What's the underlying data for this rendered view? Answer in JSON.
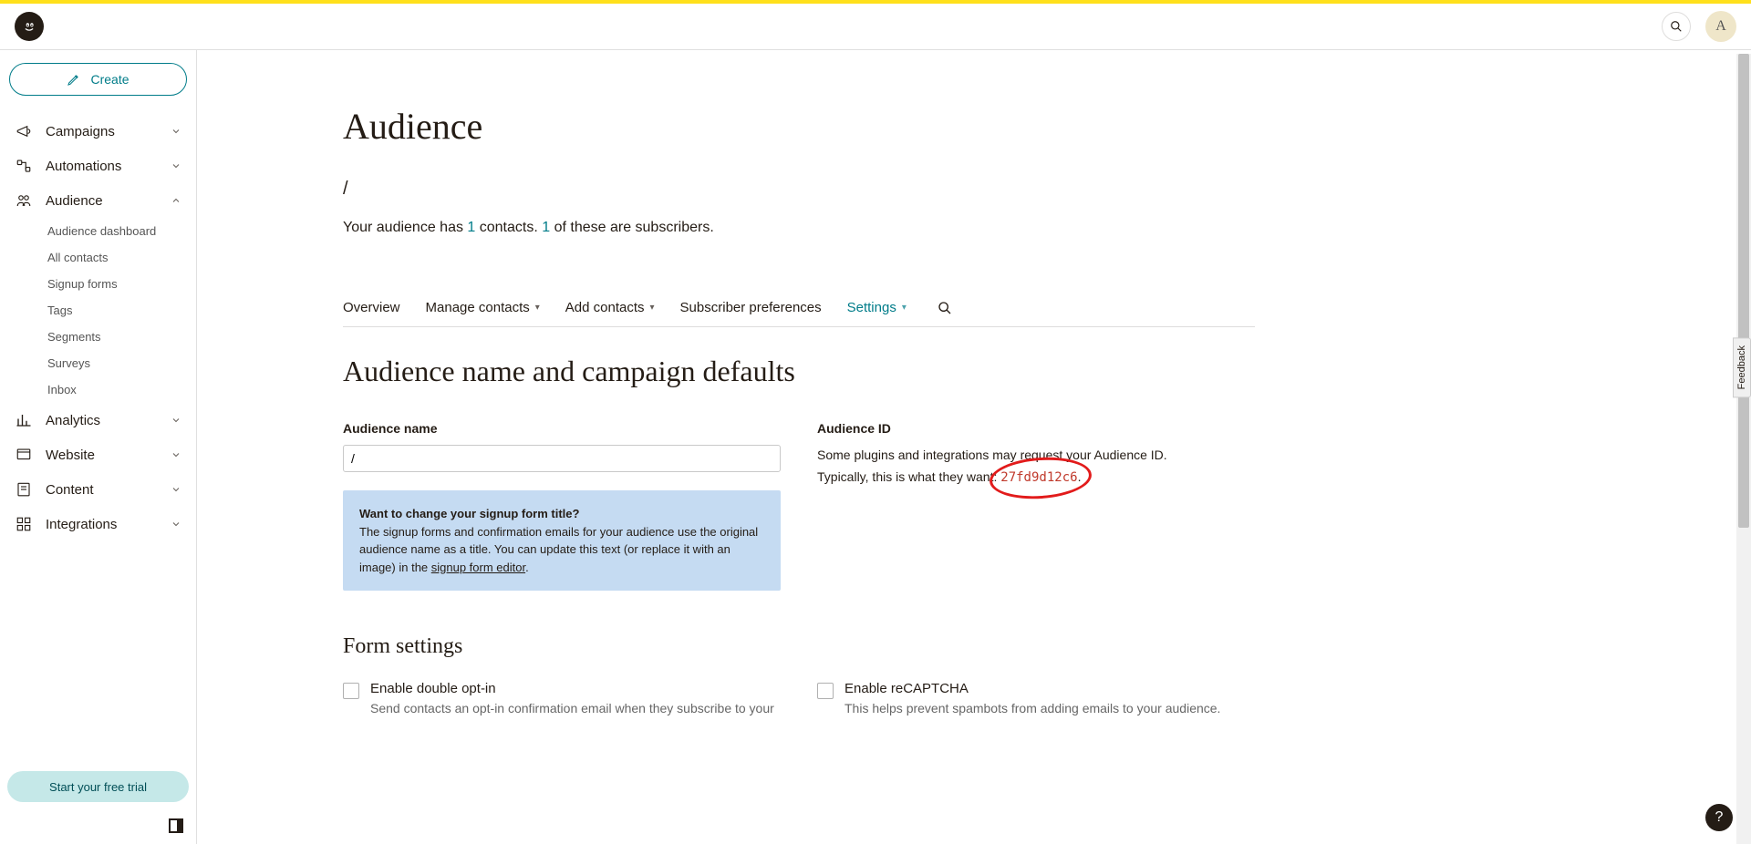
{
  "header": {
    "avatar_initial": "A"
  },
  "sidebar": {
    "create_label": "Create",
    "items": [
      {
        "label": "Campaigns",
        "expanded": false
      },
      {
        "label": "Automations",
        "expanded": false
      },
      {
        "label": "Audience",
        "expanded": true
      },
      {
        "label": "Analytics",
        "expanded": false
      },
      {
        "label": "Website",
        "expanded": false
      },
      {
        "label": "Content",
        "expanded": false
      },
      {
        "label": "Integrations",
        "expanded": false
      }
    ],
    "audience_subitems": [
      "Audience dashboard",
      "All contacts",
      "Signup forms",
      "Tags",
      "Segments",
      "Surveys",
      "Inbox"
    ],
    "trial_label": "Start your free trial"
  },
  "page": {
    "title": "Audience",
    "subtitle": "/",
    "contact_line_pre": "Your audience has ",
    "contact_count": "1",
    "contact_line_mid": " contacts. ",
    "subscriber_count": "1",
    "contact_line_post": " of these are subscribers."
  },
  "tabs": {
    "items": [
      {
        "label": "Overview",
        "dropdown": false,
        "active": false
      },
      {
        "label": "Manage contacts",
        "dropdown": true,
        "active": false
      },
      {
        "label": "Add contacts",
        "dropdown": true,
        "active": false
      },
      {
        "label": "Subscriber preferences",
        "dropdown": false,
        "active": false
      },
      {
        "label": "Settings",
        "dropdown": true,
        "active": true
      }
    ]
  },
  "section": {
    "title": "Audience name and campaign defaults",
    "audience_name_label": "Audience name",
    "audience_name_value": "/",
    "info_title": "Want to change your signup form title?",
    "info_body": "The signup forms and confirmation emails for your audience use the original audience name as a title. You can update this text (or replace it with an image) in the ",
    "info_link": "signup form editor",
    "audience_id_label": "Audience ID",
    "audience_id_help1": "Some plugins and integrations may request your Audience ID.",
    "audience_id_help2_pre": "Typically, this is what they want: ",
    "audience_id_value": "27fd9d12c6"
  },
  "form_settings": {
    "title": "Form settings",
    "opt1_label": "Enable double opt-in",
    "opt1_desc": "Send contacts an opt-in confirmation email when they subscribe to your",
    "opt2_label": "Enable reCAPTCHA",
    "opt2_desc": "This helps prevent spambots from adding emails to your audience."
  },
  "misc": {
    "feedback": "Feedback",
    "help": "?"
  }
}
